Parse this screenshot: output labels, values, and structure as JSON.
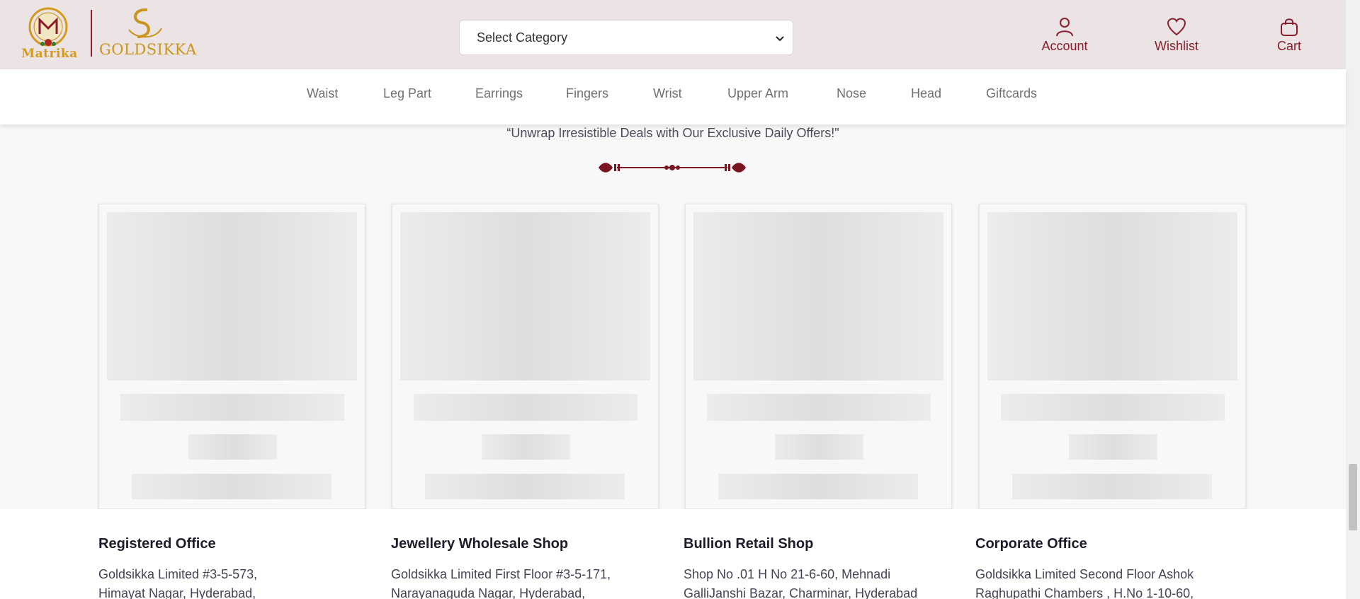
{
  "brand": {
    "logo_left_text": "Matrika",
    "logo_right_text": "GOLDSIKKA",
    "color_primary": "#8b1c2c",
    "color_gold": "#d49a1b",
    "header_bg": "#ebe3e4"
  },
  "header": {
    "category_select_value": "Select Category",
    "actions": [
      {
        "label": "Account",
        "icon": "user-icon"
      },
      {
        "label": "Wishlist",
        "icon": "heart-icon"
      },
      {
        "label": "Cart",
        "icon": "bag-icon"
      }
    ]
  },
  "nav": {
    "items": [
      "Waist",
      "Leg Part",
      "Earrings",
      "Fingers",
      "Wrist",
      "Upper Arm",
      "Nose",
      "Head",
      "Giftcards"
    ]
  },
  "deals": {
    "tagline": "“Unwrap Irresistible Deals with Our Exclusive Daily Offers!\"",
    "cards_loading": 4
  },
  "footer": {
    "offices": [
      {
        "title": "Registered Office",
        "lines": [
          "Goldsikka Limited #3-5-573,",
          "Himayat Nagar, Hyderabad,"
        ]
      },
      {
        "title": "Jewellery Wholesale Shop",
        "lines": [
          "Goldsikka Limited First Floor #3-5-171,",
          "Narayanaguda Nagar, Hyderabad,"
        ]
      },
      {
        "title": "Bullion Retail Shop",
        "lines": [
          "Shop No .01 H No 21-6-60, Mehnadi",
          "GalliJanshi Bazar, Charminar, Hyderabad"
        ]
      },
      {
        "title": "Corporate Office",
        "lines": [
          "Goldsikka Limited Second Floor Ashok",
          "Raghupathi Chambers , H.No 1-10-60,"
        ]
      }
    ]
  }
}
